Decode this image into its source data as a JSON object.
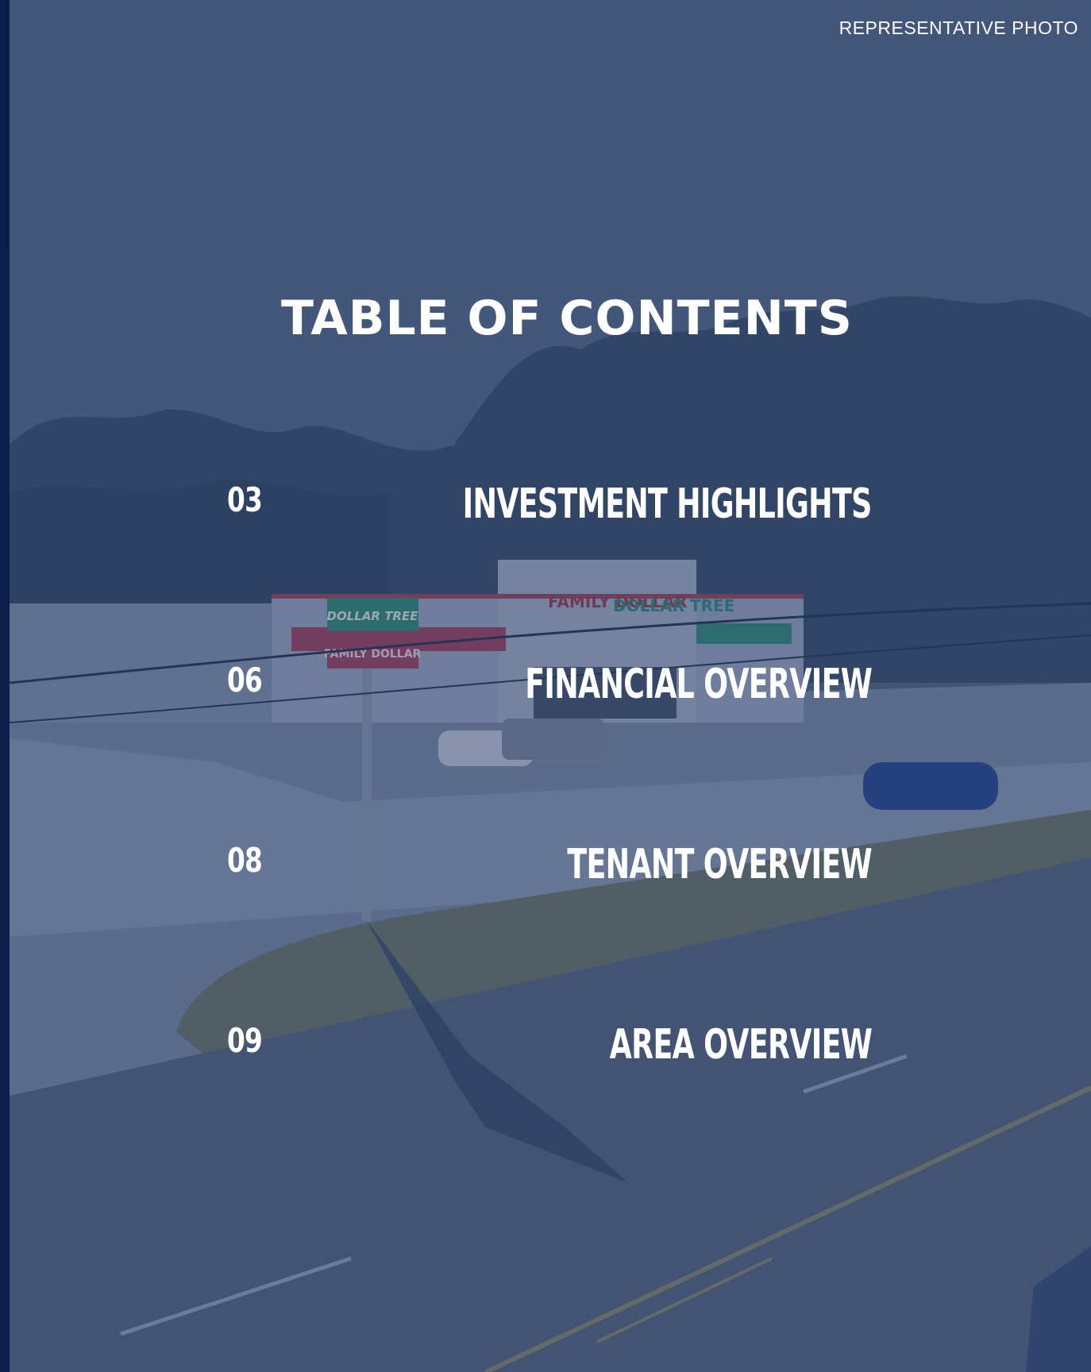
{
  "caption": "REPRESENTATIVE PHOTO",
  "title": "TABLE OF CONTENTS",
  "toc": [
    {
      "page": "03",
      "label": "INVESTMENT HIGHLIGHTS"
    },
    {
      "page": "06",
      "label": "FINANCIAL OVERVIEW"
    },
    {
      "page": "08",
      "label": "TENANT OVERVIEW"
    },
    {
      "page": "09",
      "label": "AREA OVERVIEW"
    }
  ],
  "colors": {
    "navy": "#0b1f4a",
    "overlay": "#163064",
    "text": "#ffffff"
  },
  "photo": {
    "signs": {
      "pole_top": "DOLLAR TREE",
      "pole_bottom": "FAMILY DOLLAR",
      "facade_left": "FAMILY DOLLAR",
      "facade_right": "DOLLAR TREE"
    }
  }
}
